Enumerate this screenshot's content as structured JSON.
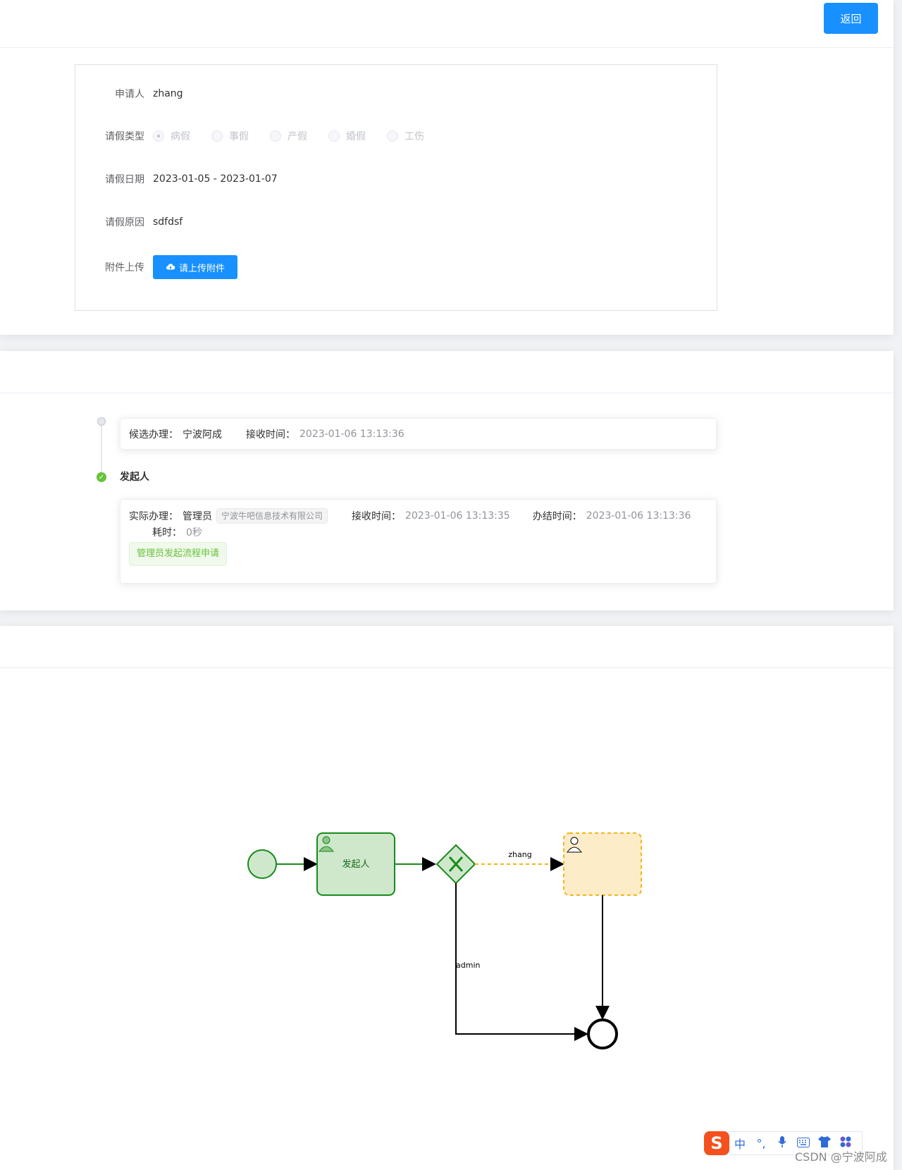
{
  "header": {
    "back_label": "返回"
  },
  "form": {
    "applicant_label": "申请人",
    "applicant_value": "zhang",
    "leave_type_label": "请假类型",
    "leave_types": [
      "病假",
      "事假",
      "产假",
      "婚假",
      "工伤"
    ],
    "leave_type_selected": "病假",
    "date_label": "请假日期",
    "date_value": "2023-01-05 - 2023-01-07",
    "reason_label": "请假原因",
    "reason_value": "sdfdsf",
    "attachment_label": "附件上传",
    "upload_button": "请上传附件"
  },
  "timeline": {
    "item1": {
      "candidate_label": "候选办理：",
      "candidate_value": "宁波阿成",
      "receive_label": "接收时间：",
      "receive_value": "2023-01-06 13:13:36"
    },
    "item2": {
      "title": "发起人",
      "actual_label": "实际办理：",
      "actual_value": "管理员",
      "company_tag": "宁波牛吧信息技术有限公司",
      "receive_label": "接收时间：",
      "receive_value": "2023-01-06 13:13:35",
      "finish_label": "办结时间：",
      "finish_value": "2023-01-06 13:13:36",
      "duration_label": "耗时：",
      "duration_value": "0秒",
      "comment_tag": "管理员发起流程申请"
    }
  },
  "diagram": {
    "task1_label": "发起人",
    "flow_zhang_label": "zhang",
    "flow_admin_label": "admin",
    "colors": {
      "done": "#1a8a1a",
      "done_fill": "#cfe8cc",
      "pending": "#f5b417",
      "pending_fill": "#fdecc8"
    }
  },
  "ime": {
    "items": [
      "中",
      "°,",
      "mic-icon",
      "keyboard-icon",
      "shirt-icon",
      "apps-icon"
    ]
  },
  "watermark": "CSDN @宁波阿成"
}
